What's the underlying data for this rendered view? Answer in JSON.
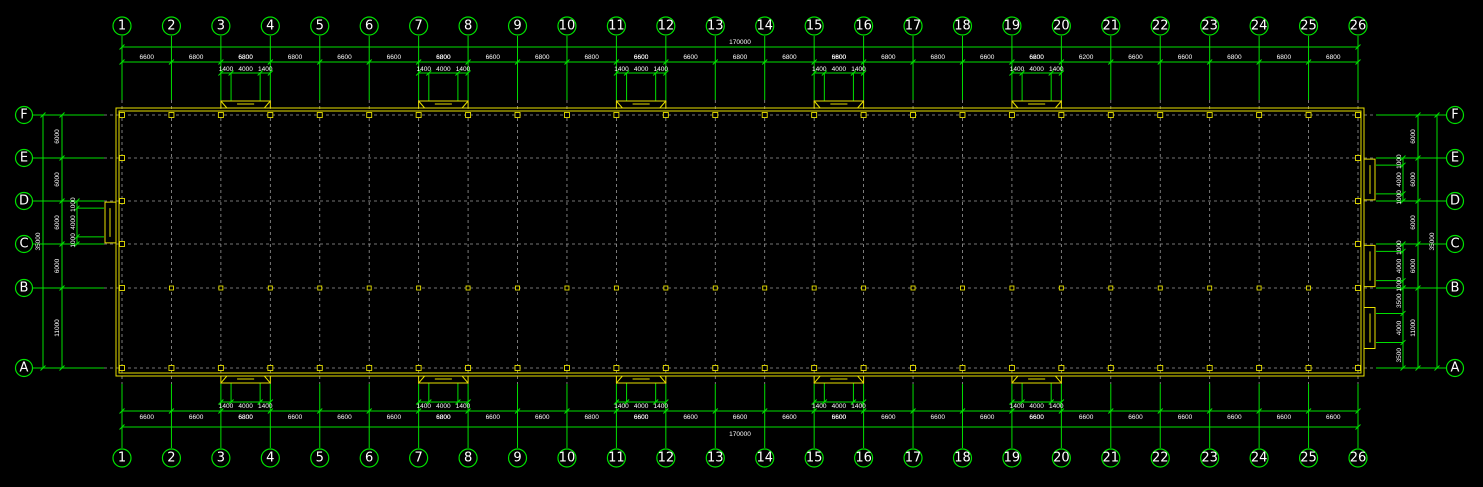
{
  "axes_x": [
    "1",
    "2",
    "3",
    "4",
    "5",
    "6",
    "7",
    "8",
    "9",
    "10",
    "11",
    "12",
    "13",
    "14",
    "15",
    "16",
    "17",
    "18",
    "19",
    "20",
    "21",
    "22",
    "23",
    "24",
    "25",
    "26"
  ],
  "axes_y": [
    "A",
    "B",
    "C",
    "D",
    "E",
    "F"
  ],
  "dims": {
    "total_length": "170000",
    "top_spans": [
      "6600",
      "6800",
      "6800",
      "6800",
      "6600",
      "6600",
      "6800",
      "6600",
      "6800",
      "6800",
      "6600",
      "6600",
      "6800",
      "6800",
      "6600",
      "6800",
      "6800",
      "6600",
      "6600",
      "6200",
      "6600",
      "6600",
      "6800",
      "6800",
      "6800"
    ],
    "bottom_spans": [
      "6600",
      "6600",
      "6800",
      "6600",
      "6600",
      "6600",
      "6800",
      "6600",
      "6600",
      "6800",
      "6600",
      "6600",
      "6600",
      "6600",
      "6600",
      "6600",
      "6600",
      "6600",
      "6600",
      "6600",
      "6600",
      "6600",
      "6600",
      "6600",
      "6600"
    ],
    "door_segments": [
      "1400",
      "4000",
      "1400"
    ],
    "door_width_top": [
      "6800",
      "6800",
      "6600",
      "6800",
      "6200"
    ],
    "door_width_bottom": [
      "6800",
      "6800",
      "6600",
      "6600",
      "6600"
    ],
    "left_overall": "35000",
    "left_spans": [
      "6000",
      "6000",
      "6000",
      "6000",
      "11000"
    ],
    "left_door": [
      "1000",
      "4000",
      "1000"
    ],
    "right_overall": "35000",
    "right_spans": [
      "6000",
      "6000",
      "6000",
      "6000",
      "11000"
    ],
    "right_door_upper": [
      "1000",
      "4000",
      "1000"
    ],
    "right_door_middle": [
      "1000",
      "4000",
      "1000"
    ],
    "right_door_lower": [
      "3500",
      "4000",
      "3500"
    ]
  },
  "colors": {
    "background": "#000000",
    "axis": "#00e000",
    "wall": "#e8e000",
    "grid": "#9a9a9a",
    "text": "#ffffff"
  }
}
